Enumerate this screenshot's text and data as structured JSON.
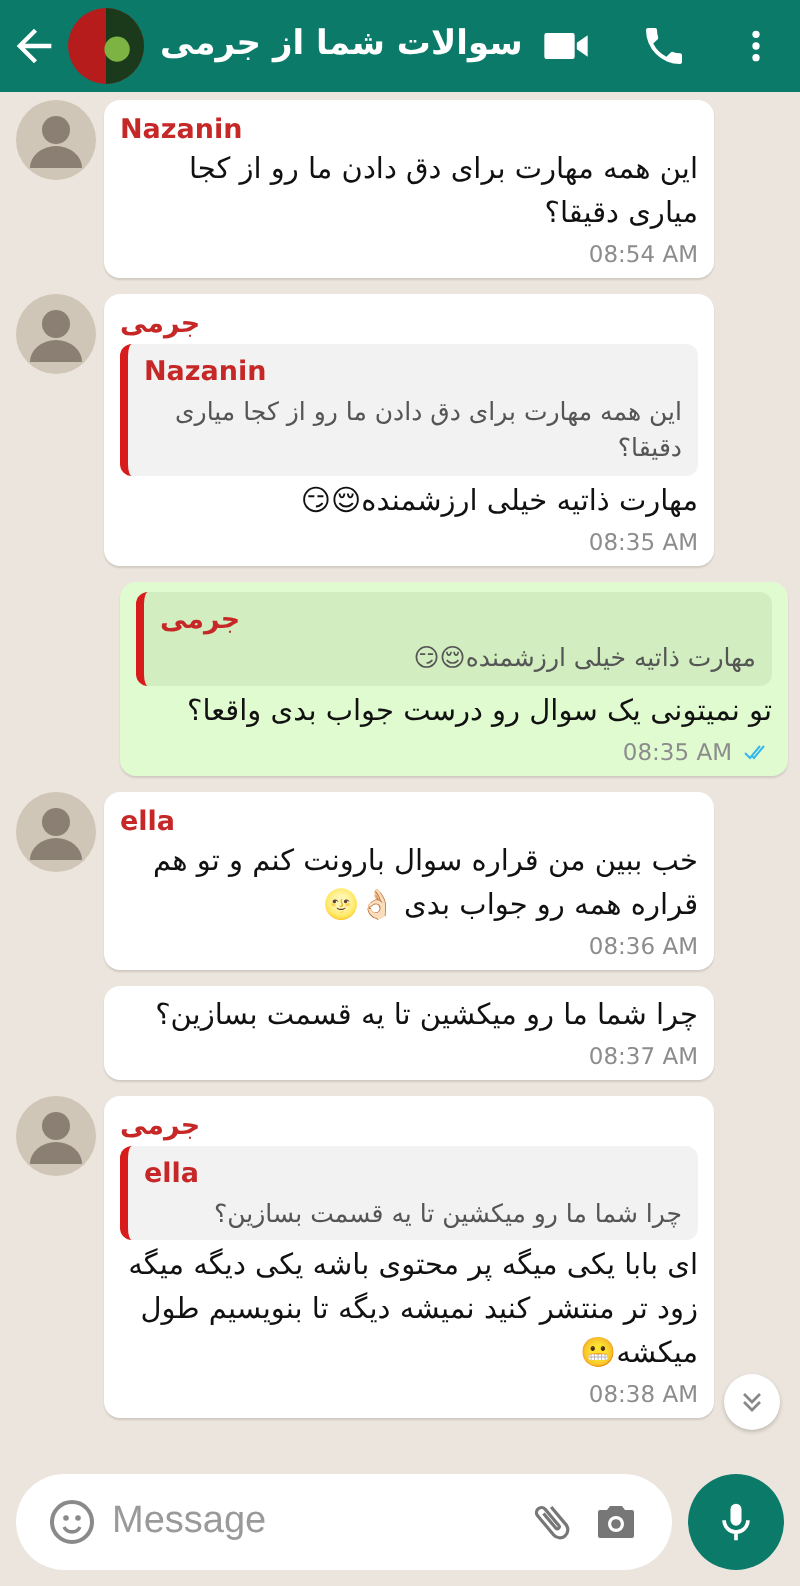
{
  "header": {
    "title": "سوالات شما از جرمی"
  },
  "messages": [
    {
      "kind": "incoming",
      "sender": "Nazanin",
      "text": "این همه مهارت برای دق دادن ما رو از کجا میاری دقیقا؟",
      "time": "08:54 AM"
    },
    {
      "kind": "incoming",
      "sender": "جرمی",
      "reply": {
        "sender": "Nazanin",
        "text": "این همه مهارت برای دق دادن ما رو از کجا میاری دقیقا؟"
      },
      "text": "مهارت ذاتیه خیلی ارزشمنده😌😏",
      "time": "08:35 AM"
    },
    {
      "kind": "outgoing",
      "reply": {
        "sender": "جرمی",
        "text": "مهارت ذاتیه خیلی ارزشمنده😌😏"
      },
      "text": "تو نمیتونی یک سوال رو درست جواب بدی واقعا؟",
      "time": "08:35 AM",
      "read": true
    },
    {
      "kind": "incoming",
      "sender": "ella",
      "text": "خب ببین من قراره سوال بارونت کنم و تو هم قراره همه رو جواب بدی 👌🏻🌝",
      "time": "08:36 AM"
    },
    {
      "kind": "incoming",
      "text": "چرا شما ما رو میکشین تا یه قسمت بسازین؟",
      "time": "08:37 AM"
    },
    {
      "kind": "incoming",
      "sender": "جرمی",
      "reply": {
        "sender": "ella",
        "text": "چرا شما ما رو میکشین تا یه قسمت بسازین؟"
      },
      "text": "ای بابا یکی میگه پر محتوی باشه یکی دیگه میگه زود تر منتشر کنید نمیشه دیگه تا بنویسیم طول میکشه😬",
      "time": "08:38 AM"
    }
  ],
  "composer": {
    "placeholder": "Message"
  }
}
